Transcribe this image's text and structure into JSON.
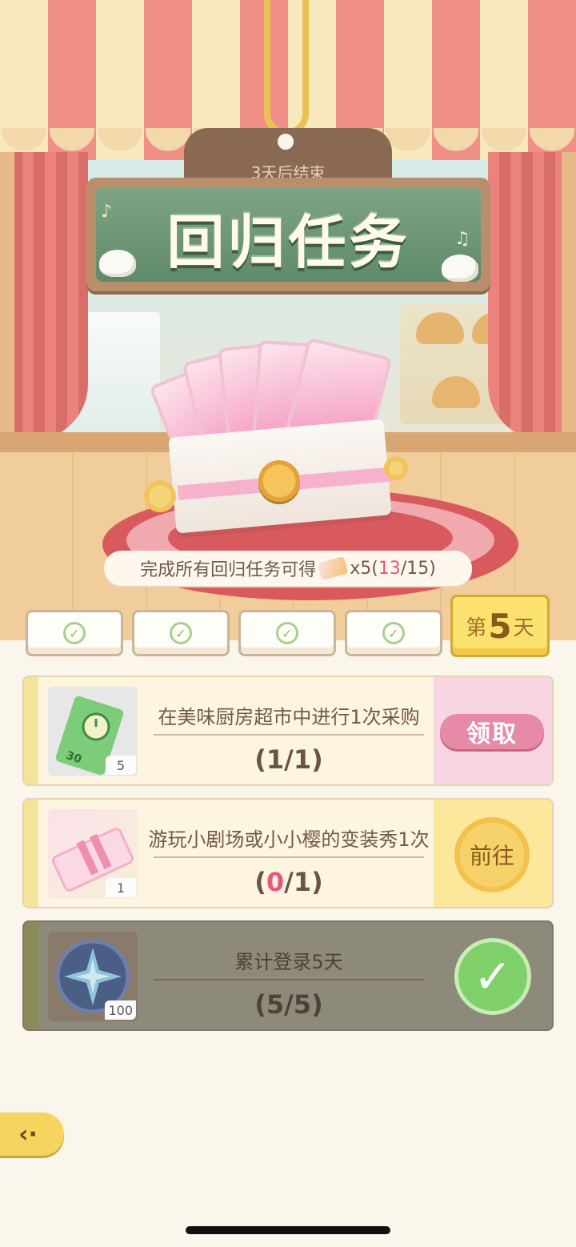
{
  "event": {
    "ends_in": "3天后结束",
    "title": "回归任务"
  },
  "reward": {
    "prefix": "完成所有回归任务可得",
    "multiplier": "x5",
    "open": "(",
    "progress_done": "13",
    "progress_rest": "/15)"
  },
  "days": {
    "completed_count": 4,
    "active_prefix": "第",
    "active_num": "5",
    "active_suffix": "天"
  },
  "tasks": [
    {
      "desc": "在美味厨房超市中进行1次采购",
      "progress_open": "(",
      "progress_cur": "1",
      "progress_rest": "/1)",
      "count": "5",
      "icon": "time-ticket-30min-icon",
      "action": "领取",
      "state": "claimable"
    },
    {
      "desc": "游玩小剧场或小小樱的变装秀1次",
      "progress_open": "(",
      "progress_cur": "0",
      "progress_rest": "/1)",
      "count": "1",
      "icon": "sakura-ticket-icon",
      "action": "前往",
      "state": "in-progress"
    },
    {
      "desc": "累计登录5天",
      "progress_open": "(",
      "progress_cur": "5",
      "progress_rest": "/5)",
      "count": "100",
      "icon": "star-coin-icon",
      "action": "",
      "state": "claimed"
    }
  ],
  "colors": {
    "accent_pink": "#e6567e",
    "claim_button": "#e68aa7",
    "go_button": "#f2c24c",
    "done_check": "#7fcf6a"
  }
}
